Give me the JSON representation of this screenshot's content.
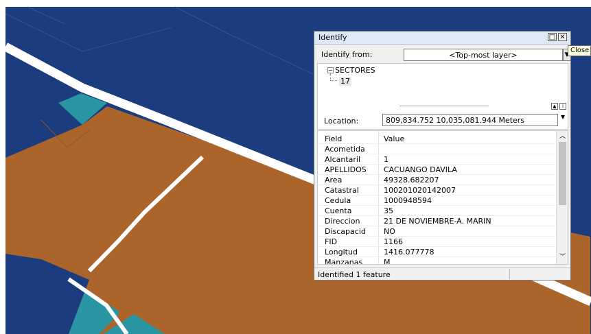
{
  "colors": {
    "water": "#1b3c7e",
    "parcel_orange": "#ab6429",
    "parcel_teal": "#2a96a4",
    "road": "#ffffff"
  },
  "identify": {
    "title": "Identify",
    "restore_icon": "restore-icon",
    "close_icon": "close-icon",
    "from_label": "Identify from:",
    "from_value": "<Top-most layer>",
    "tooltip": "Close",
    "tree": {
      "root_label": "SECTORES",
      "child_label": "17"
    },
    "location_label": "Location:",
    "location_value": "809,834.752  10,035,081.944 Meters",
    "table": {
      "headers": [
        "Field",
        "Value"
      ],
      "rows": [
        {
          "field": "Acometida",
          "value": ""
        },
        {
          "field": "Alcantaril",
          "value": "1"
        },
        {
          "field": "APELLIDOS",
          "value": "CACUANGO DAVILA"
        },
        {
          "field": "Area",
          "value": "49328.682207"
        },
        {
          "field": "Catastral",
          "value": "100201020142007"
        },
        {
          "field": "Cedula",
          "value": "1000948594"
        },
        {
          "field": "Cuenta",
          "value": "35"
        },
        {
          "field": "Direccion",
          "value": "21 DE NOVIEMBRE-A. MARIN"
        },
        {
          "field": "Discapacid",
          "value": "NO"
        },
        {
          "field": "FID",
          "value": "1166"
        },
        {
          "field": "Longitud",
          "value": "1416.077778"
        },
        {
          "field": "Manzanas",
          "value": "M"
        }
      ]
    },
    "status": "Identified 1 feature"
  }
}
